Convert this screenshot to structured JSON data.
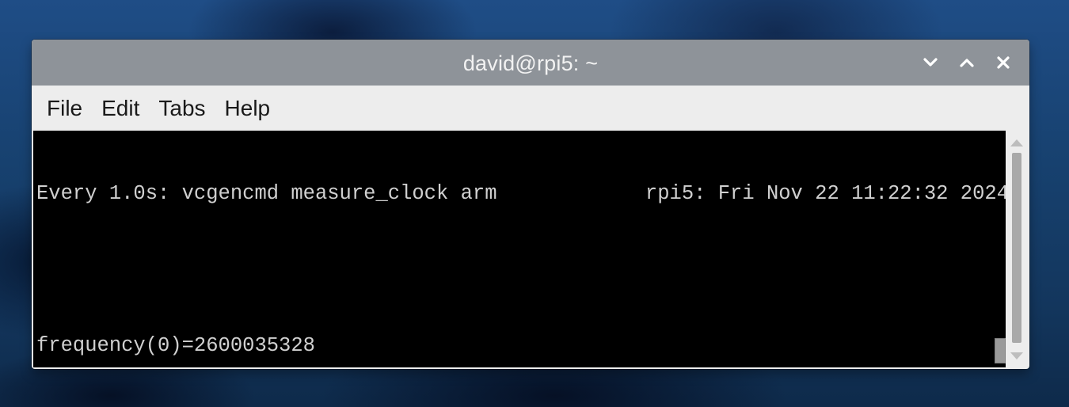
{
  "window": {
    "title": "david@rpi5: ~",
    "controls": {
      "minimize_icon": "chevron-down-icon",
      "maximize_icon": "chevron-up-icon",
      "close_icon": "close-icon"
    }
  },
  "menubar": {
    "items": [
      "File",
      "Edit",
      "Tabs",
      "Help"
    ]
  },
  "terminal": {
    "header_left": "Every 1.0s: vcgencmd measure_clock arm",
    "header_right": "rpi5: Fri Nov 22 11:22:32 2024",
    "output_line": "frequency(0)=2600035328"
  },
  "colors": {
    "titlebar": "#8e9399",
    "terminal_bg": "#000000",
    "terminal_fg": "#d0d0d0",
    "menubar": "#ededed"
  }
}
